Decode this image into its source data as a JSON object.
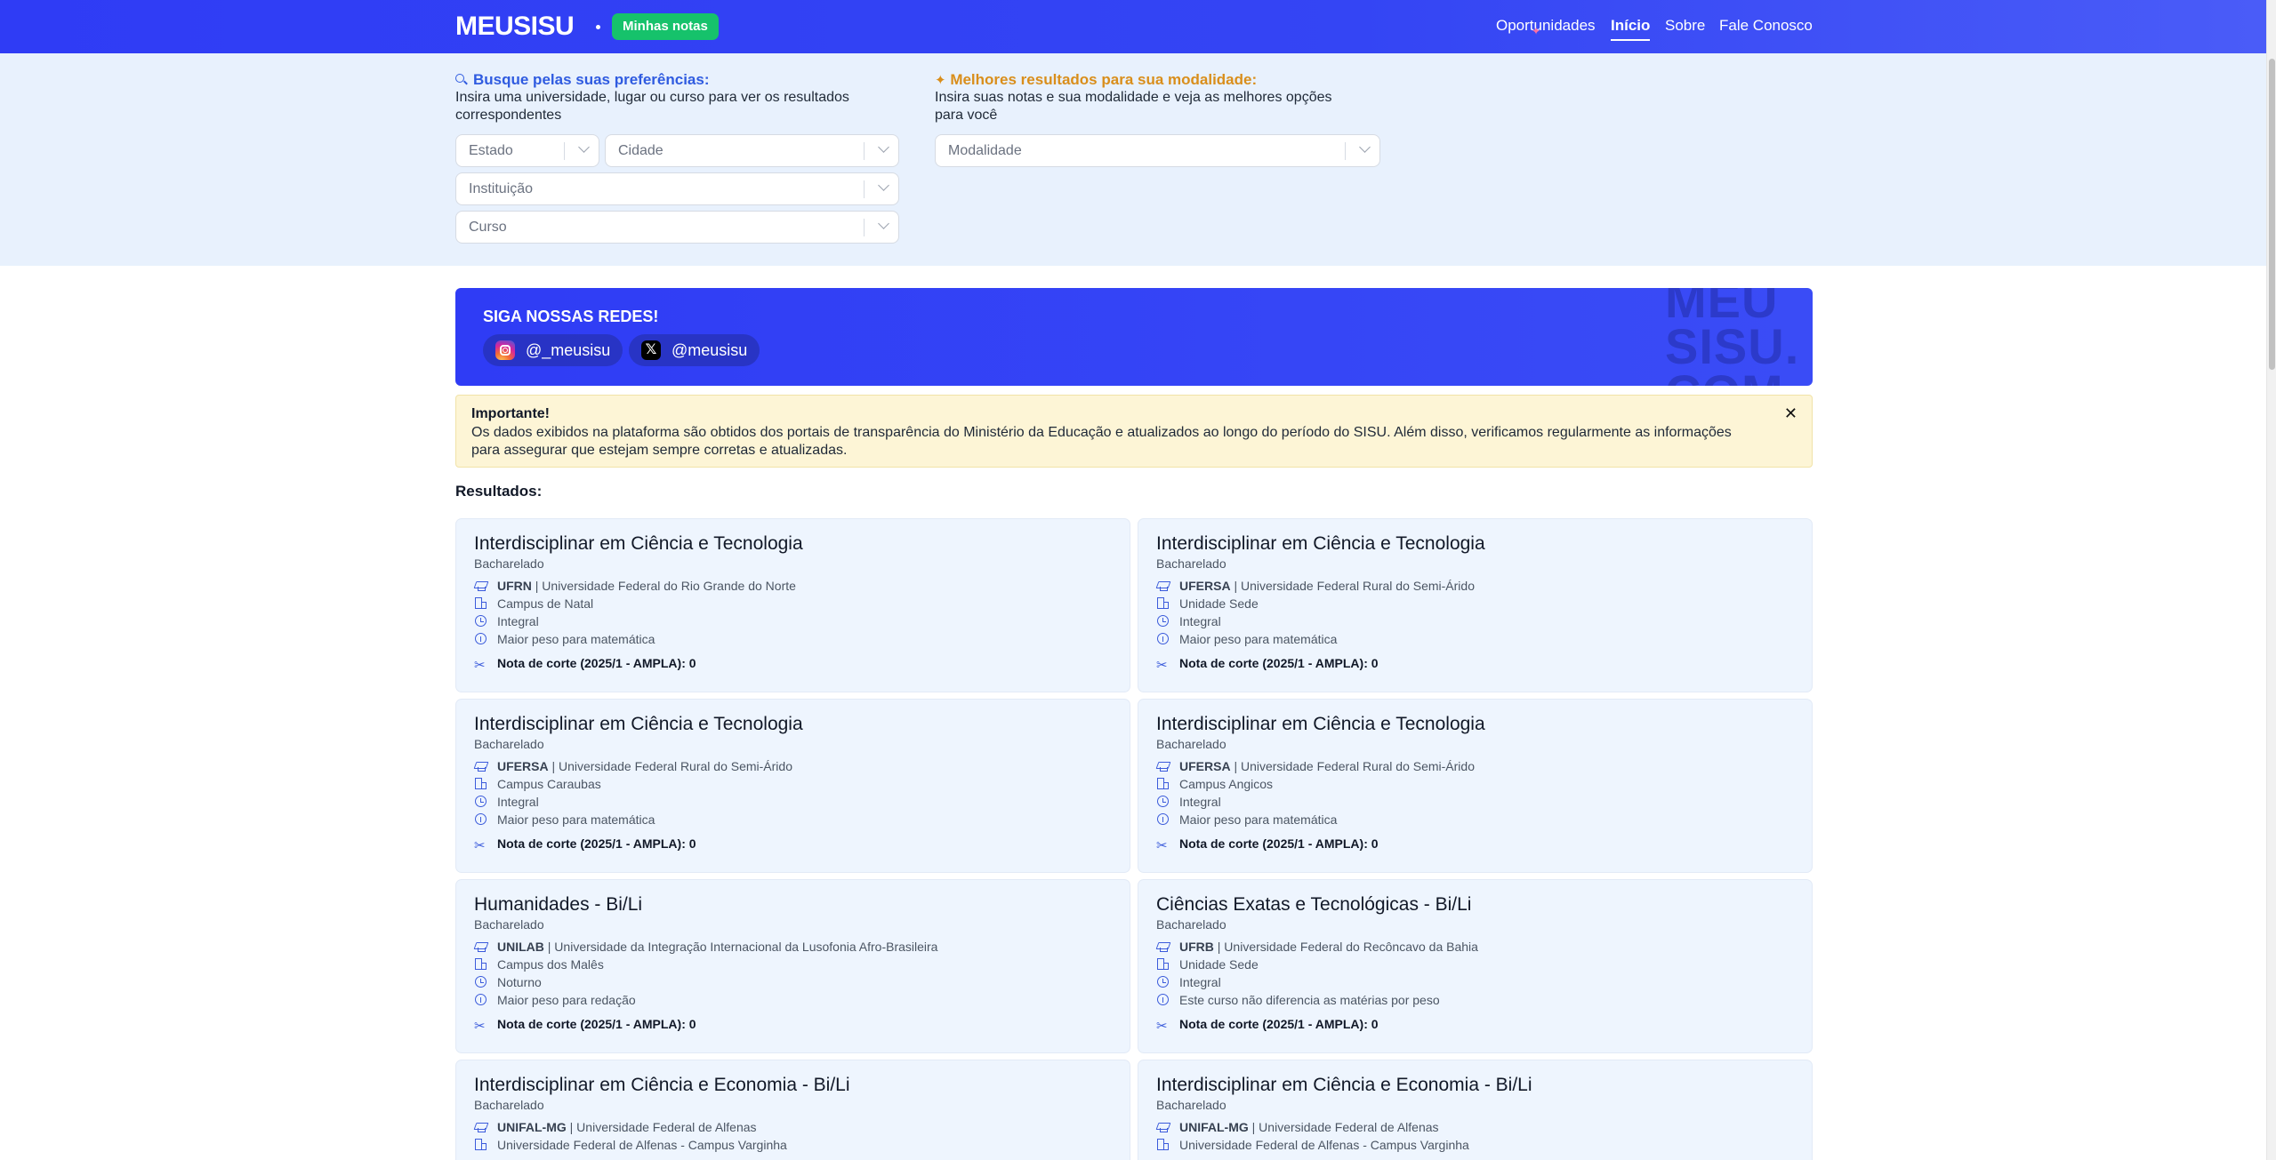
{
  "header": {
    "logo": "MEUSISU",
    "notes_button": "Minhas notas",
    "nav": {
      "opportunities": "Oportunidades",
      "home": "Início",
      "about": "Sobre",
      "contact": "Fale Conosco"
    }
  },
  "search": {
    "preferences_title": "Busque pelas suas preferências:",
    "preferences_desc": "Insira uma universidade, lugar ou curso para ver os resultados correspondentes",
    "best_title": "Melhores resultados para sua modalidade:",
    "best_desc": "Insira suas notas e sua modalidade e veja as melhores opções para você",
    "state_placeholder": "Estado",
    "city_placeholder": "Cidade",
    "institution_placeholder": "Instituição",
    "course_placeholder": "Curso",
    "modality_placeholder": "Modalidade"
  },
  "social": {
    "title": "SIGA NOSSAS REDES!",
    "instagram": "@_meusisu",
    "x": "@meusisu",
    "watermark": [
      "MEU",
      "SISU.",
      "COM"
    ]
  },
  "notice": {
    "title": "Importante!",
    "text": "Os dados exibidos na plataforma são obtidos dos portais de transparência do Ministério da Educação e atualizados ao longo do período do SISU. Além disso, verificamos regularmente as informações para assegurar que estejam sempre corretas e atualizadas.",
    "close": "✕"
  },
  "results": {
    "label": "Resultados:",
    "cards": [
      {
        "title": "Interdisciplinar em Ciência e Tecnologia",
        "degree": "Bacharelado",
        "acronym": "UFRN",
        "university": "| Universidade Federal do Rio Grande do Norte",
        "campus": "Campus de Natal",
        "shift": "Integral",
        "weight": "Maior peso para matemática",
        "cutoff": "Nota de corte (2025/1 - AMPLA): 0"
      },
      {
        "title": "Interdisciplinar em Ciência e Tecnologia",
        "degree": "Bacharelado",
        "acronym": "UFERSA",
        "university": "| Universidade Federal Rural do Semi-Árido",
        "campus": "Unidade Sede",
        "shift": "Integral",
        "weight": "Maior peso para matemática",
        "cutoff": "Nota de corte (2025/1 - AMPLA): 0"
      },
      {
        "title": "Interdisciplinar em Ciência e Tecnologia",
        "degree": "Bacharelado",
        "acronym": "UFERSA",
        "university": "| Universidade Federal Rural do Semi-Árido",
        "campus": "Campus Caraubas",
        "shift": "Integral",
        "weight": "Maior peso para matemática",
        "cutoff": "Nota de corte (2025/1 - AMPLA): 0"
      },
      {
        "title": "Interdisciplinar em Ciência e Tecnologia",
        "degree": "Bacharelado",
        "acronym": "UFERSA",
        "university": "| Universidade Federal Rural do Semi-Árido",
        "campus": "Campus Angicos",
        "shift": "Integral",
        "weight": "Maior peso para matemática",
        "cutoff": "Nota de corte (2025/1 - AMPLA): 0"
      },
      {
        "title": "Humanidades - Bi/Li",
        "degree": "Bacharelado",
        "acronym": "UNILAB",
        "university": "| Universidade da Integração Internacional da Lusofonia Afro-Brasileira",
        "campus": "Campus dos Malês",
        "shift": "Noturno",
        "weight": "Maior peso para redação",
        "cutoff": "Nota de corte (2025/1 - AMPLA): 0"
      },
      {
        "title": "Ciências Exatas e Tecnológicas - Bi/Li",
        "degree": "Bacharelado",
        "acronym": "UFRB",
        "university": "| Universidade Federal do Recôncavo da Bahia",
        "campus": "Unidade Sede",
        "shift": "Integral",
        "weight": "Este curso não diferencia as matérias por peso",
        "cutoff": "Nota de corte (2025/1 - AMPLA): 0"
      },
      {
        "title": "Interdisciplinar em Ciência e Economia - Bi/Li",
        "degree": "Bacharelado",
        "acronym": "UNIFAL-MG",
        "university": "| Universidade Federal de Alfenas",
        "campus": "Universidade Federal de Alfenas - Campus Varginha",
        "shift": "",
        "weight": "",
        "cutoff": ""
      },
      {
        "title": "Interdisciplinar em Ciência e Economia - Bi/Li",
        "degree": "Bacharelado",
        "acronym": "UNIFAL-MG",
        "university": "| Universidade Federal de Alfenas",
        "campus": "Universidade Federal de Alfenas - Campus Varginha",
        "shift": "",
        "weight": "",
        "cutoff": ""
      }
    ]
  },
  "colors": {
    "brand_blue": "#2f3cf5",
    "notes_green": "#16c26b",
    "search_bg": "#e8f1fd",
    "notice_bg": "#fdf5d6",
    "card_bg": "#eef5fe"
  }
}
